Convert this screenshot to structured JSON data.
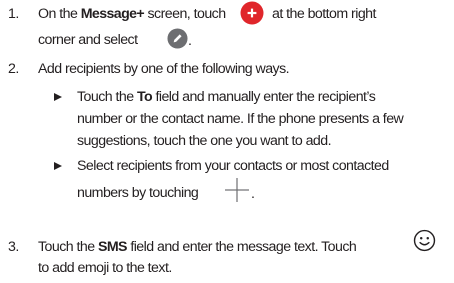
{
  "steps": [
    {
      "number": "1.",
      "line1_a": "On the ",
      "line1_bold": "Message+",
      "line1_b": " screen, touch",
      "line1_c": "at the bottom right",
      "line2": "corner and select",
      "line2_end": "."
    },
    {
      "number": "2.",
      "line1": "Add recipients by one of the following ways."
    },
    {
      "number": "3.",
      "line1_a": "Touch the ",
      "line1_bold": "SMS",
      "line1_b": " field and enter the message text. Touch",
      "line2": "to add emoji to the text."
    }
  ],
  "bullets": [
    {
      "line1_a": "Touch the ",
      "line1_bold": "To",
      "line1_b": " field and manually enter the recipient’s",
      "line2": "number or the contact name. If the phone presents a few",
      "line3": "suggestions, touch the one you want to add."
    },
    {
      "line1": "Select recipients from your contacts or most contacted",
      "line2": "numbers by touching",
      "line2_end": "."
    }
  ],
  "icons": {
    "new_message": "red-plus-fab-icon",
    "compose": "pencil-icon",
    "add": "plus-icon",
    "emoji": "smiley-face-icon"
  },
  "colors": {
    "text": "#231f20",
    "fab_red": "#e0262b",
    "compose_gray": "#6d6e71"
  }
}
